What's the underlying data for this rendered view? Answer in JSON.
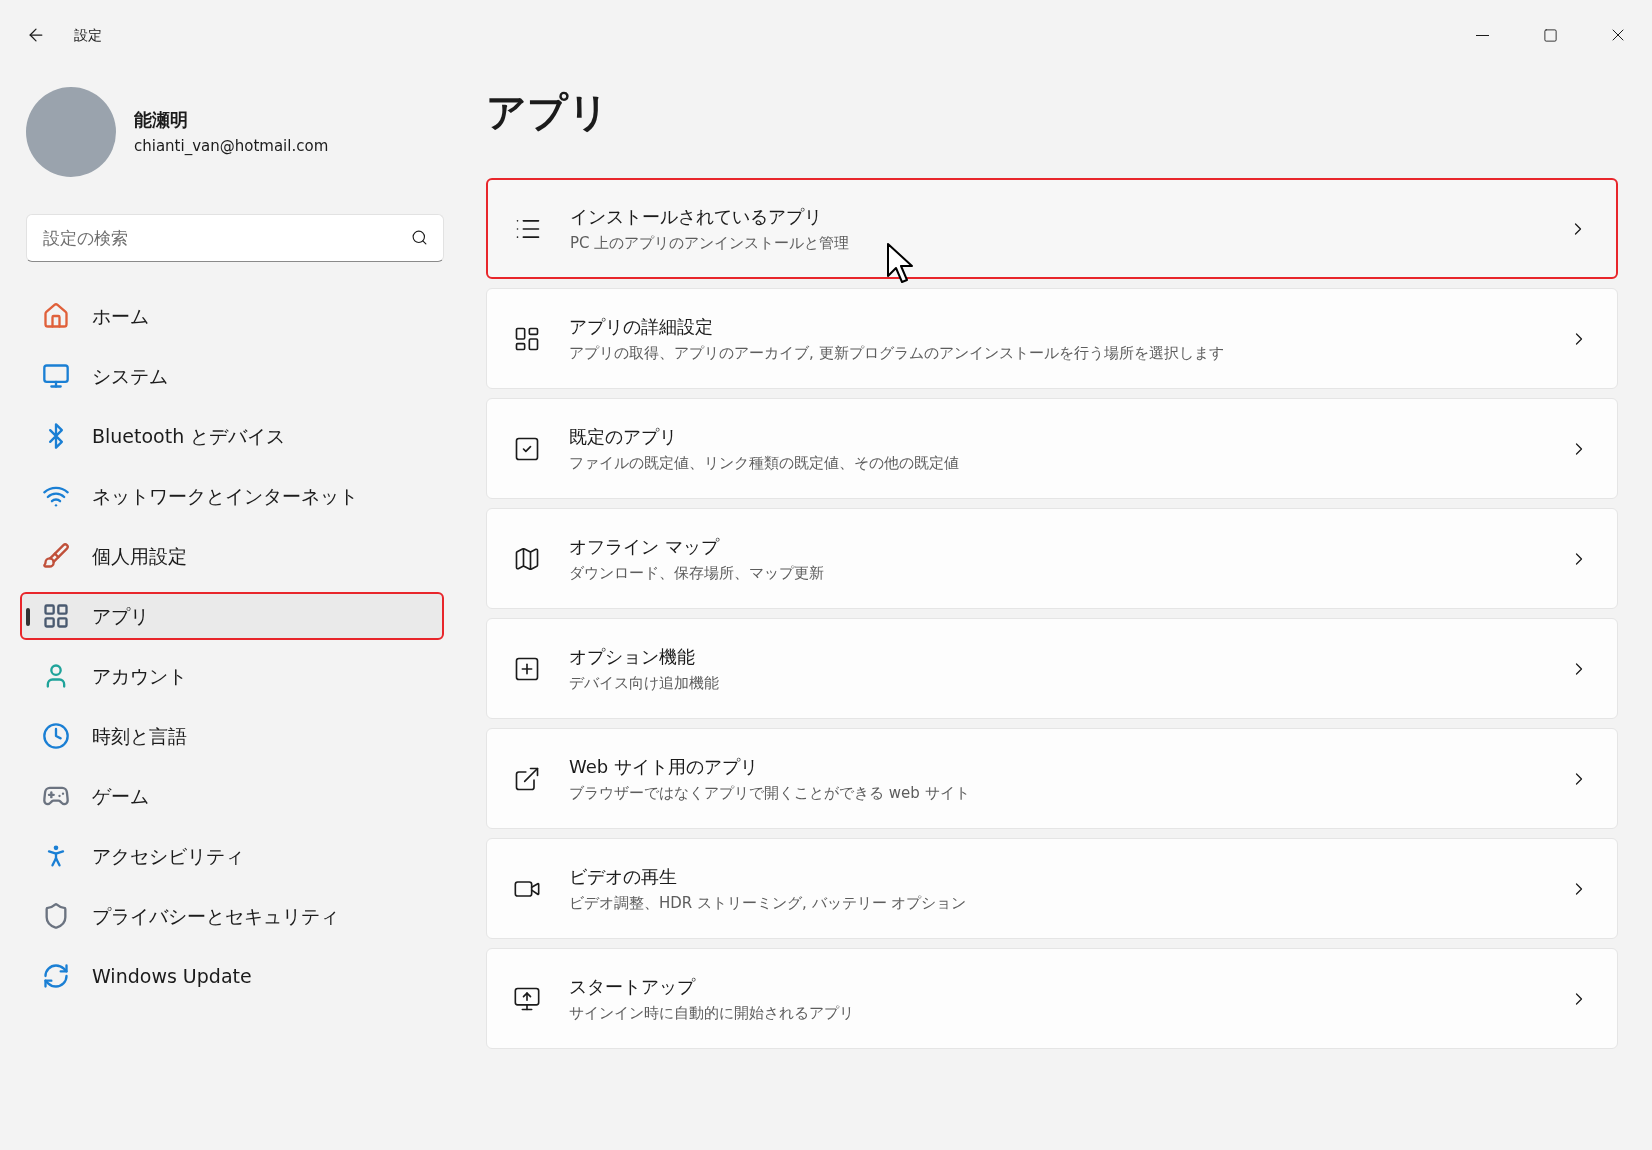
{
  "window": {
    "title": "設定"
  },
  "profile": {
    "name": "能瀬明",
    "email": "chianti_van@hotmail.com"
  },
  "search": {
    "placeholder": "設定の検索"
  },
  "nav": [
    {
      "label": "ホーム",
      "selected": false,
      "annotated": false
    },
    {
      "label": "システム",
      "selected": false,
      "annotated": false
    },
    {
      "label": "Bluetooth とデバイス",
      "selected": false,
      "annotated": false
    },
    {
      "label": "ネットワークとインターネット",
      "selected": false,
      "annotated": false
    },
    {
      "label": "個人用設定",
      "selected": false,
      "annotated": false
    },
    {
      "label": "アプリ",
      "selected": true,
      "annotated": true
    },
    {
      "label": "アカウント",
      "selected": false,
      "annotated": false
    },
    {
      "label": "時刻と言語",
      "selected": false,
      "annotated": false
    },
    {
      "label": "ゲーム",
      "selected": false,
      "annotated": false
    },
    {
      "label": "アクセシビリティ",
      "selected": false,
      "annotated": false
    },
    {
      "label": "プライバシーとセキュリティ",
      "selected": false,
      "annotated": false
    },
    {
      "label": "Windows Update",
      "selected": false,
      "annotated": false
    }
  ],
  "page_title": "アプリ",
  "cards": [
    {
      "title": "インストールされているアプリ",
      "subtitle": "PC 上のアプリのアンインストールと管理",
      "annotated": true,
      "hovered": true
    },
    {
      "title": "アプリの詳細設定",
      "subtitle": "アプリの取得、アプリのアーカイブ, 更新プログラムのアンインストールを行う場所を選択します",
      "annotated": false,
      "hovered": false
    },
    {
      "title": "既定のアプリ",
      "subtitle": "ファイルの既定値、リンク種類の既定値、その他の既定値",
      "annotated": false,
      "hovered": false
    },
    {
      "title": "オフライン マップ",
      "subtitle": "ダウンロード、保存場所、マップ更新",
      "annotated": false,
      "hovered": false
    },
    {
      "title": "オプション機能",
      "subtitle": "デバイス向け追加機能",
      "annotated": false,
      "hovered": false
    },
    {
      "title": "Web サイト用のアプリ",
      "subtitle": "ブラウザーではなくアプリで開くことができる web サイト",
      "annotated": false,
      "hovered": false
    },
    {
      "title": "ビデオの再生",
      "subtitle": "ビデオ調整、HDR ストリーミング, バッテリー オプション",
      "annotated": false,
      "hovered": false
    },
    {
      "title": "スタートアップ",
      "subtitle": "サインイン時に自動的に開始されるアプリ",
      "annotated": false,
      "hovered": false
    }
  ]
}
